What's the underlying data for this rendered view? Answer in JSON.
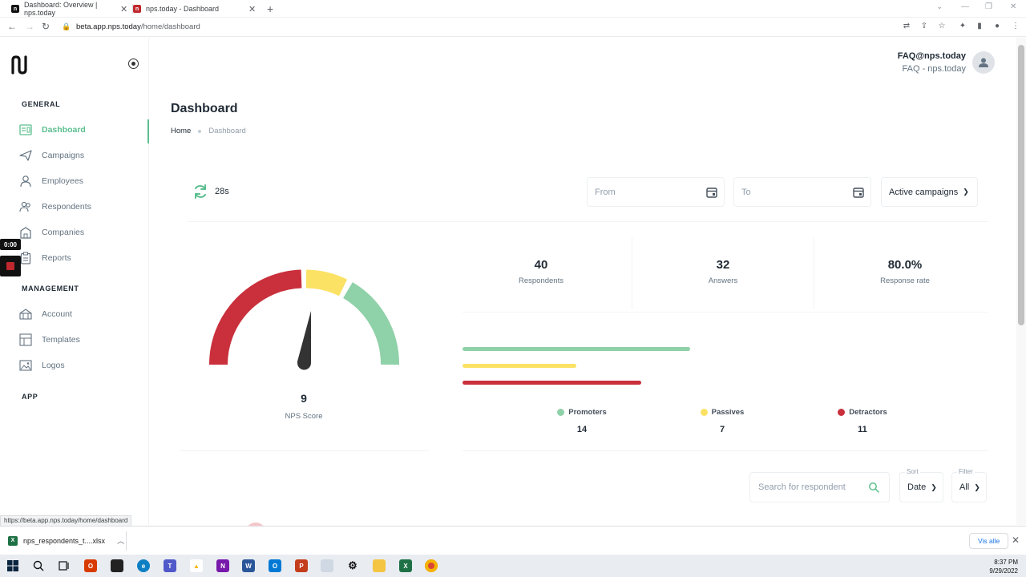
{
  "browser": {
    "tabs": [
      {
        "title": "Dashboard: Overview | nps.today",
        "favicon": "nps-icon"
      },
      {
        "title": "nps.today - Dashboard",
        "favicon": "nps-red-icon"
      }
    ],
    "url_domain": "beta.app.nps.today",
    "url_path": "/home/dashboard",
    "status_url": "https://beta.app.nps.today/home/dashboard"
  },
  "sidebar": {
    "sections": {
      "general": "GENERAL",
      "management": "MANAGEMENT",
      "app": "APP"
    },
    "general_items": [
      {
        "label": "Dashboard",
        "icon": "dashboard-icon",
        "active": true
      },
      {
        "label": "Campaigns",
        "icon": "send-icon"
      },
      {
        "label": "Employees",
        "icon": "user-icon"
      },
      {
        "label": "Respondents",
        "icon": "users-icon"
      },
      {
        "label": "Companies",
        "icon": "building-icon"
      },
      {
        "label": "Reports",
        "icon": "clipboard-icon"
      }
    ],
    "management_items": [
      {
        "label": "Account",
        "icon": "account-icon"
      },
      {
        "label": "Templates",
        "icon": "templates-icon"
      },
      {
        "label": "Logos",
        "icon": "image-icon"
      }
    ],
    "recorder_time": "0:00"
  },
  "user": {
    "name": "FAQ@nps.today",
    "company": "FAQ - nps.today"
  },
  "page": {
    "title": "Dashboard",
    "breadcrumb_home": "Home",
    "breadcrumb_current": "Dashboard"
  },
  "filters": {
    "refresh_countdown": "28s",
    "from_placeholder": "From",
    "to_placeholder": "To",
    "campaign_select": "Active campaigns"
  },
  "nps": {
    "score": "9",
    "label": "NPS Score"
  },
  "stats": [
    {
      "value": "40",
      "label": "Respondents"
    },
    {
      "value": "32",
      "label": "Answers"
    },
    {
      "value": "80.0%",
      "label": "Response rate"
    }
  ],
  "distribution": [
    {
      "label": "Promoters",
      "value": "14",
      "count": 14,
      "color": "#8fd1a8"
    },
    {
      "label": "Passives",
      "value": "7",
      "count": 7,
      "color": "#fbe264"
    },
    {
      "label": "Detractors",
      "value": "11",
      "count": 11,
      "color": "#c9303c"
    }
  ],
  "list_controls": {
    "search_placeholder": "Search for respondent",
    "sort_caption": "Sort",
    "sort_value": "Date",
    "filter_caption": "Filter",
    "filter_value": "All"
  },
  "downloads": {
    "file": "nps_respondents_t....xlsx",
    "show_all": "Vis alle"
  },
  "taskbar": {
    "time": "8:37 PM",
    "date": "9/29/2022"
  }
}
